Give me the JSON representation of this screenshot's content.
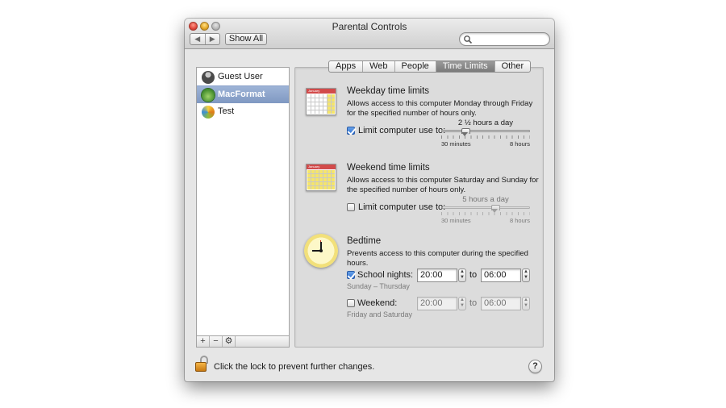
{
  "window": {
    "title": "Parental Controls",
    "show_all_label": "Show All",
    "back_glyph": "◀",
    "forward_glyph": "▶",
    "search_placeholder": ""
  },
  "users": [
    {
      "name": "Guest User",
      "avatar": "guest-silhouette"
    },
    {
      "name": "MacFormat",
      "avatar": "green-leaf",
      "selected": true
    },
    {
      "name": "Test",
      "avatar": "colorful-flower"
    }
  ],
  "list_toolbar": {
    "add": "+",
    "remove": "−",
    "action": "⚙"
  },
  "tabs": [
    {
      "label": "Apps",
      "active": false
    },
    {
      "label": "Web",
      "active": false
    },
    {
      "label": "People",
      "active": false
    },
    {
      "label": "Time Limits",
      "active": true
    },
    {
      "label": "Other",
      "active": false
    }
  ],
  "weekday": {
    "title": "Weekday time limits",
    "desc": "Allows access to this computer Monday through Friday for the specified number of hours only.",
    "checkbox_label": "Limit computer use to:",
    "checked": true,
    "value_label": "2 ½ hours a day",
    "min_label": "30 minutes",
    "max_label": "8 hours",
    "level": 0.27
  },
  "weekend": {
    "title": "Weekend time limits",
    "desc": "Allows access to this computer Saturday and Sunday for the specified number of hours only.",
    "checkbox_label": "Limit computer use to:",
    "checked": false,
    "value_label": "5 hours a day",
    "min_label": "30 minutes",
    "max_label": "8 hours",
    "level": 0.6
  },
  "bedtime": {
    "title": "Bedtime",
    "desc": "Prevents access to this computer during the specified hours.",
    "school": {
      "label": "School nights:",
      "checked": true,
      "from": "20:00",
      "to": "06:00",
      "sub": "Sunday – Thursday"
    },
    "weekend": {
      "label": "Weekend:",
      "checked": false,
      "from": "20:00",
      "to": "06:00",
      "sub": "Friday and Saturday"
    },
    "to_label": "to"
  },
  "footer": {
    "lock_text": "Click the lock to prevent further changes.",
    "help_label": "?"
  },
  "calendar_header": "January",
  "colors": {
    "accent": "#2d6fd1",
    "selection": "#8aa0c8",
    "lock": "#e09a26"
  }
}
